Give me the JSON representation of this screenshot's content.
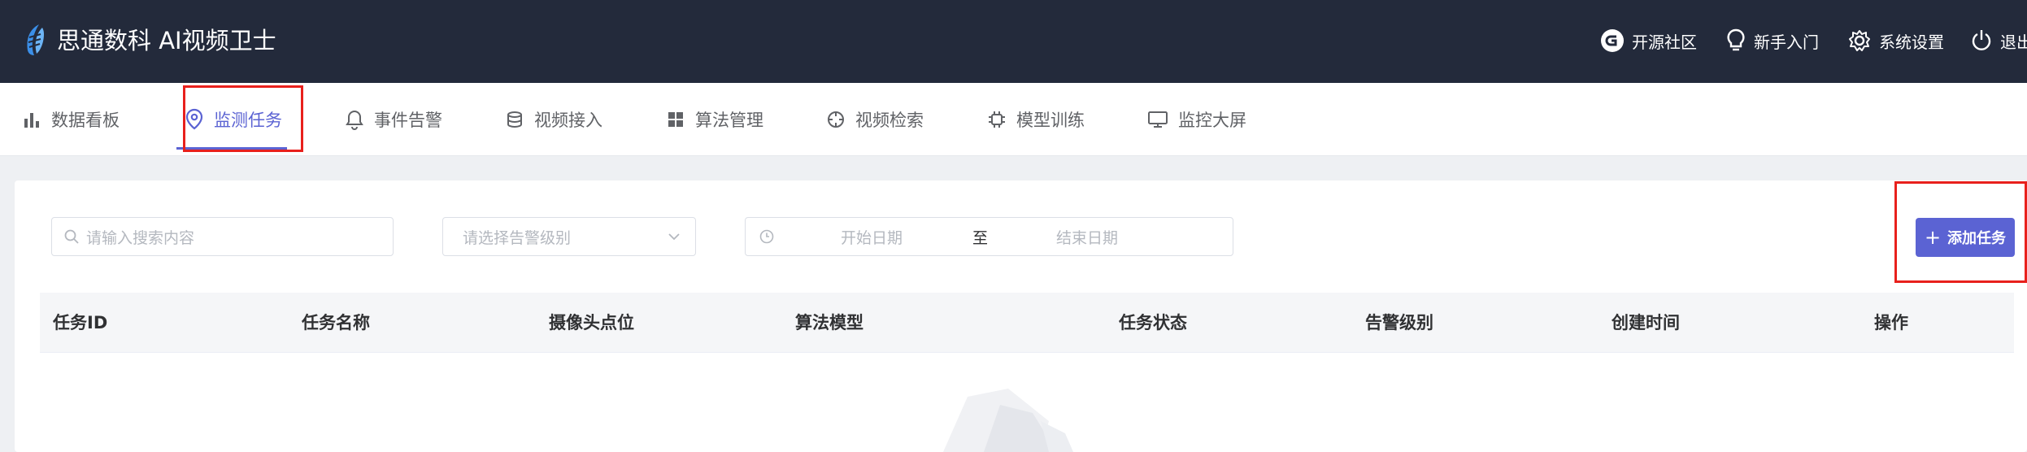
{
  "header": {
    "title": "思通数科 AI视频卫士",
    "links": [
      {
        "label": "开源社区",
        "icon": "github-icon"
      },
      {
        "label": "新手入门",
        "icon": "lightbulb-icon"
      },
      {
        "label": "系统设置",
        "icon": "gear-icon"
      },
      {
        "label": "退出",
        "icon": "power-icon"
      }
    ]
  },
  "nav": {
    "items": [
      {
        "label": "数据看板",
        "icon": "bar-chart-icon"
      },
      {
        "label": "监测任务",
        "icon": "location-pin-icon",
        "active": true
      },
      {
        "label": "事件告警",
        "icon": "bell-icon"
      },
      {
        "label": "视频接入",
        "icon": "database-icon"
      },
      {
        "label": "算法管理",
        "icon": "grid-icon"
      },
      {
        "label": "视频检索",
        "icon": "compass-icon"
      },
      {
        "label": "模型训练",
        "icon": "cpu-icon"
      },
      {
        "label": "监控大屏",
        "icon": "monitor-icon"
      }
    ]
  },
  "filters": {
    "search_placeholder": "请输入搜索内容",
    "level_placeholder": "请选择告警级别",
    "start_date_placeholder": "开始日期",
    "range_separator": "至",
    "end_date_placeholder": "结束日期"
  },
  "toolbar": {
    "add_label": "添加任务"
  },
  "table": {
    "columns": [
      "任务ID",
      "任务名称",
      "摄像头点位",
      "算法模型",
      "任务状态",
      "告警级别",
      "创建时间",
      "操作"
    ]
  },
  "colors": {
    "header_bg": "#232a3b",
    "accent": "#5b63d3",
    "annotation": "#e8201c"
  }
}
